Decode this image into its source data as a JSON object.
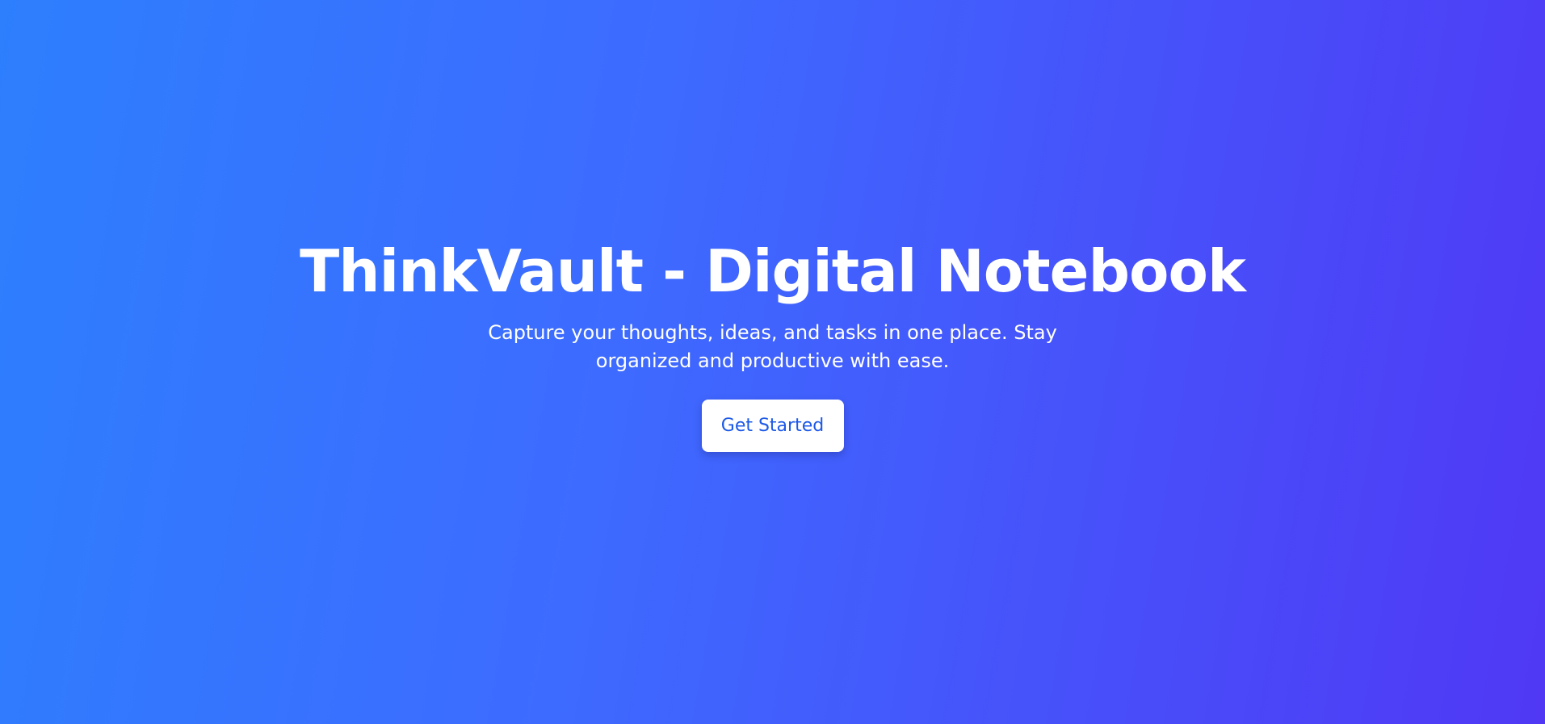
{
  "hero": {
    "title": "ThinkVault - Digital Notebook",
    "subtitle": "Capture your thoughts, ideas, and tasks in one place. Stay organized and productive with ease.",
    "cta_label": "Get Started"
  },
  "colors": {
    "gradient_start": "#2d7ffe",
    "gradient_mid": "#3d6bff",
    "gradient_end": "#5038f5",
    "text": "#ffffff",
    "button_background": "#ffffff",
    "button_text": "#1d5ae8"
  }
}
